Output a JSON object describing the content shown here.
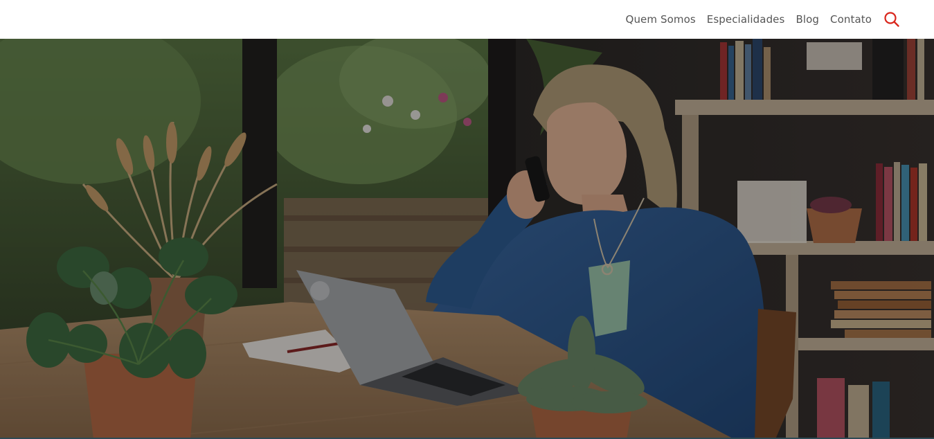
{
  "nav": {
    "items": [
      {
        "label": "Quem Somos"
      },
      {
        "label": "Especialidades"
      },
      {
        "label": "Blog"
      },
      {
        "label": "Contato"
      }
    ],
    "search_icon": "search-icon"
  },
  "colors": {
    "accent": "#d9261c",
    "nav_text": "#555555",
    "header_bg": "#ffffff"
  },
  "hero": {
    "image": "hero-photo"
  }
}
